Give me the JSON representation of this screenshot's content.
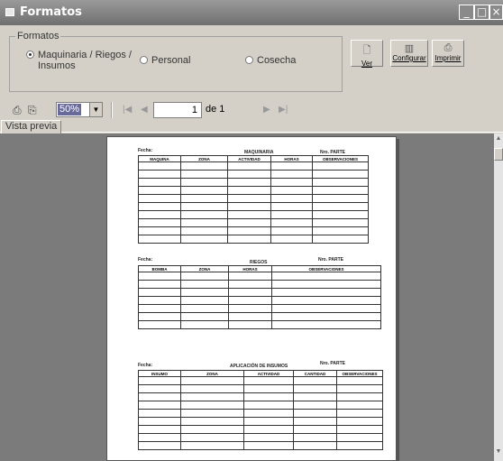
{
  "window": {
    "title": "Formatos"
  },
  "formatos": {
    "group_label": "Formatos",
    "options": [
      {
        "label_line1": "Maquinaria / Riegos /",
        "label_line2": "Insumos",
        "selected": true
      },
      {
        "label": "Personal",
        "selected": false
      },
      {
        "label": "Cosecha",
        "selected": false
      }
    ]
  },
  "actions": {
    "ver": "Ver",
    "configurar": "Configurar",
    "imprimir": "Imprimir"
  },
  "toolbar": {
    "zoom": "50%",
    "page_value": "1",
    "page_of": "de 1"
  },
  "tabs": [
    {
      "label": "Vista previa"
    }
  ],
  "report": {
    "s1": {
      "fecha": "Fecha:",
      "title": "MAQUINARIA",
      "parte": "Nro. PARTE",
      "columns": [
        "MAQUINA",
        "ZONA",
        "ACTIVIDAD",
        "HORAS",
        "OBSERVACIONES"
      ]
    },
    "s2": {
      "fecha": "Fecha:",
      "title": "RIEGOS",
      "parte": "Nro. PARTE",
      "columns": [
        "BOMBA",
        "ZONA",
        "HORAS",
        "OBSERVACIONES"
      ]
    },
    "s3": {
      "fecha": "Fecha:",
      "title": "APLICACIÓN DE INSUMOS",
      "parte": "Nro. PARTE",
      "columns": [
        "INSUMO",
        "ZONA",
        "ACTIVIDAD",
        "CANTIDAD",
        "OBSERVACIONES"
      ]
    }
  }
}
